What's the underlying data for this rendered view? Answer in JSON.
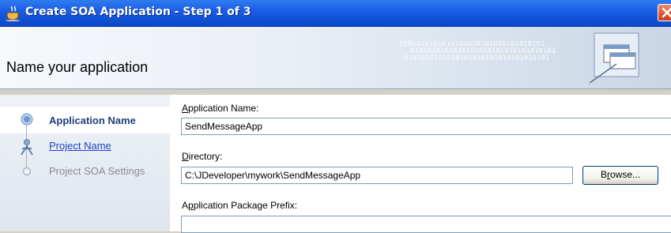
{
  "window": {
    "title": "Create SOA Application - Step 1 of 3",
    "close_glyph": "✕"
  },
  "banner": {
    "title": "Name your application",
    "pattern_text": "0101010101010101010101010101010101"
  },
  "steps": [
    {
      "label": "Application Name",
      "state": "current"
    },
    {
      "label": "Project Name",
      "state": "link"
    },
    {
      "label": "Project SOA Settings",
      "state": "disabled"
    }
  ],
  "form": {
    "app_name": {
      "label_mnemonic": "A",
      "label_rest": "pplication Name:",
      "value": "SendMessageApp"
    },
    "directory": {
      "label_mnemonic": "D",
      "label_rest": "irectory:",
      "value": "C:\\JDeveloper\\mywork\\SendMessageApp"
    },
    "browse": {
      "label_pre": "B",
      "label_mnemonic": "r",
      "label_rest": "owse..."
    },
    "package_prefix": {
      "label_pre": "A",
      "label_mnemonic": "p",
      "label_rest": "plication Package Prefix:",
      "value": ""
    }
  },
  "colors": {
    "titlebar": "#0b48c8",
    "close_button": "#de5a36",
    "step_current": "#1d3f7a",
    "step_link": "#1f3ec8",
    "step_disabled": "#8a8a8a"
  }
}
